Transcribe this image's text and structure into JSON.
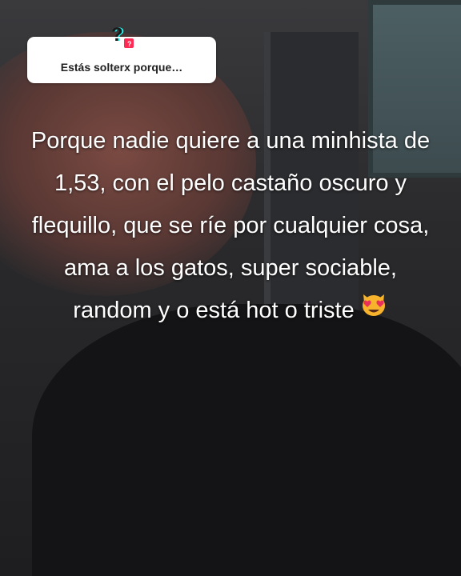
{
  "question": {
    "text": "Estás solterx porque…"
  },
  "caption": {
    "text": "Porque nadie quiere a una minhista de 1,53, con el pelo castaño oscuro y flequillo, que se ríe por cualquier cosa, ama a los gatos, super sociable, random y o está hot o triste"
  },
  "icons": {
    "question": "question-mark-icon",
    "emoji": "heart-eyes-cat-icon"
  },
  "colors": {
    "accent_red": "#fe2c55",
    "accent_cyan": "#25f4ee",
    "card_bg": "#ffffff"
  }
}
